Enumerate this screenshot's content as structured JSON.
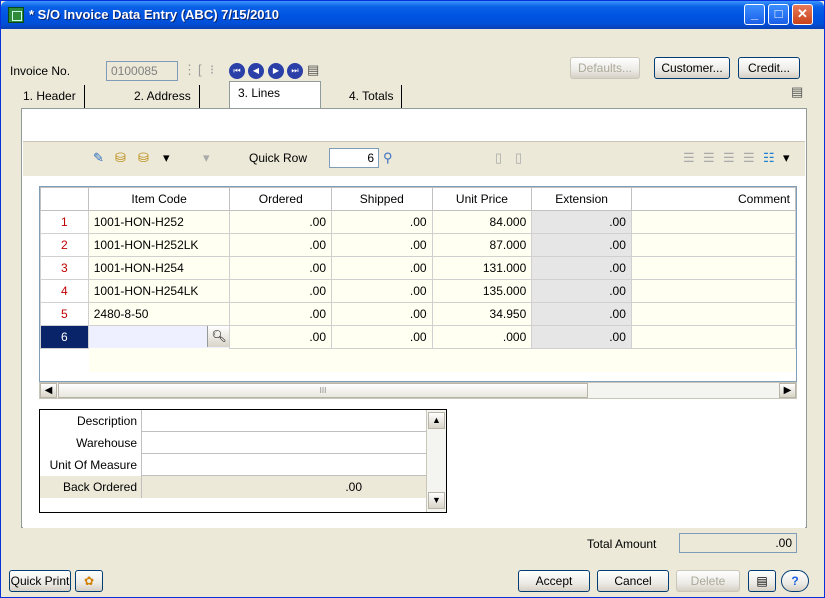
{
  "window": {
    "title": "* S/O Invoice Data Entry (ABC) 7/15/2010",
    "minimize_glyph": "_",
    "maximize_glyph": "□",
    "close_glyph": "✕"
  },
  "header": {
    "invoice_label": "Invoice No.",
    "invoice_value": "0100085",
    "defaults_label": "Defaults...",
    "customer_label": "Customer...",
    "credit_label": "Credit..."
  },
  "tabs": [
    {
      "label": "1. Header"
    },
    {
      "label": "2. Address"
    },
    {
      "label": "3. Lines"
    },
    {
      "label": "4. Totals"
    }
  ],
  "toolbar": {
    "quick_row_label": "Quick Row",
    "quick_row_value": "6"
  },
  "grid": {
    "columns": [
      "Item Code",
      "Ordered",
      "Shipped",
      "Unit Price",
      "Extension",
      "Comment"
    ],
    "rows": [
      {
        "num": "1",
        "item": "1001-HON-H252",
        "ordered": ".00",
        "shipped": ".00",
        "price": "84.000",
        "ext": ".00",
        "comment": ""
      },
      {
        "num": "2",
        "item": "1001-HON-H252LK",
        "ordered": ".00",
        "shipped": ".00",
        "price": "87.000",
        "ext": ".00",
        "comment": ""
      },
      {
        "num": "3",
        "item": "1001-HON-H254",
        "ordered": ".00",
        "shipped": ".00",
        "price": "131.000",
        "ext": ".00",
        "comment": ""
      },
      {
        "num": "4",
        "item": "1001-HON-H254LK",
        "ordered": ".00",
        "shipped": ".00",
        "price": "135.000",
        "ext": ".00",
        "comment": ""
      },
      {
        "num": "5",
        "item": "2480-8-50",
        "ordered": ".00",
        "shipped": ".00",
        "price": "34.950",
        "ext": ".00",
        "comment": ""
      },
      {
        "num": "6",
        "item": "",
        "ordered": ".00",
        "shipped": ".00",
        "price": ".000",
        "ext": ".00",
        "comment": ""
      }
    ],
    "selected_row": 6,
    "scroll_thumb_glyph": "III"
  },
  "detail": {
    "description_label": "Description",
    "description_value": "",
    "warehouse_label": "Warehouse",
    "warehouse_value": "",
    "uom_label": "Unit Of Measure",
    "uom_value": "",
    "backordered_label": "Back Ordered",
    "backordered_value": ".00"
  },
  "totals": {
    "total_amount_label": "Total Amount",
    "total_amount_value": ".00"
  },
  "footer": {
    "quick_print_label": "Quick Print",
    "accept_label": "Accept",
    "cancel_label": "Cancel",
    "delete_label": "Delete",
    "help_glyph": "?"
  },
  "colors": {
    "title_bar": "#0054e3",
    "selected_row": "#0a246a",
    "row_number": "#c00000"
  }
}
